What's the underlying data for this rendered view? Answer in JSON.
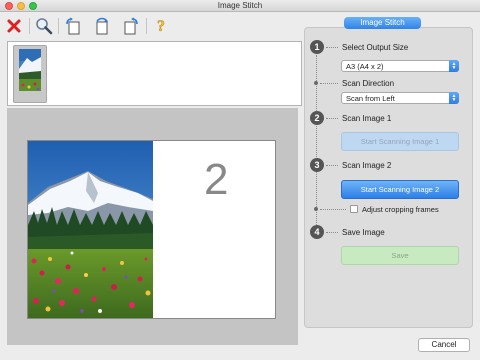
{
  "window": {
    "title": "Image Stitch"
  },
  "toolbar": {
    "items": [
      {
        "icon": "close-red-x-icon"
      },
      {
        "icon": "magnifier-icon"
      },
      {
        "icon": "rotate-left-icon"
      },
      {
        "icon": "rotate-180-icon"
      },
      {
        "icon": "rotate-right-icon"
      },
      {
        "icon": "help-icon"
      }
    ]
  },
  "preview": {
    "page_number": "2"
  },
  "panel": {
    "tab_label": "Image Stitch",
    "steps": [
      {
        "number": "1",
        "label": "Select Output Size"
      },
      {
        "number": "2",
        "label": "Scan Image 1"
      },
      {
        "number": "3",
        "label": "Scan Image 2"
      },
      {
        "number": "4",
        "label": "Save Image"
      }
    ],
    "output_size": {
      "value": "A3 (A4 x 2)"
    },
    "scan_direction": {
      "label": "Scan Direction",
      "value": "Scan from Left"
    },
    "scan_image_1_button": "Start Scanning Image 1",
    "scan_image_2_button": "Start Scanning Image 2",
    "adjust_cropping": {
      "label": "Adjust cropping frames",
      "checked": false
    },
    "save_button": "Save"
  },
  "footer": {
    "cancel_label": "Cancel"
  },
  "colors": {
    "accent_blue": "#2f83ea",
    "save_green": "#c7eac1",
    "close_red": "#e02020"
  }
}
